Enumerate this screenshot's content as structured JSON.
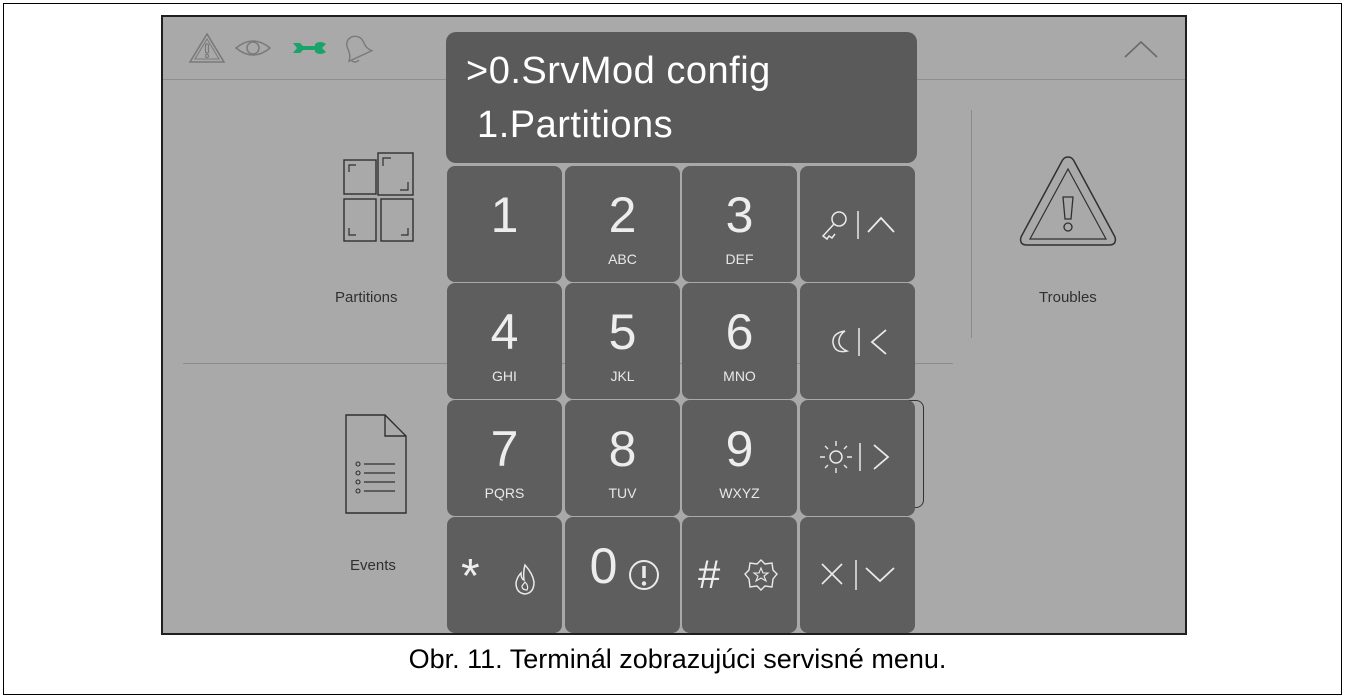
{
  "display": {
    "line1": ">0.SrvMod config",
    "line2": " 1.Partitions"
  },
  "status_icons": [
    "alarm-icon",
    "eye-icon",
    "wrench-icon",
    "bell-icon"
  ],
  "colors": {
    "wrench_active": "#1aa36a",
    "screen_bg": "#a9a9a9",
    "key_bg": "#5e5e5e"
  },
  "tiles": {
    "partitions": "Partitions",
    "troubles": "Troubles",
    "events": "Events"
  },
  "keypad": {
    "k1": {
      "digit": "1",
      "letters": ""
    },
    "k2": {
      "digit": "2",
      "letters": "ABC"
    },
    "k3": {
      "digit": "3",
      "letters": "DEF"
    },
    "k4": {
      "digit": "4",
      "letters": "GHI"
    },
    "k5": {
      "digit": "5",
      "letters": "JKL"
    },
    "k6": {
      "digit": "6",
      "letters": "MNO"
    },
    "k7": {
      "digit": "7",
      "letters": "PQRS"
    },
    "k8": {
      "digit": "8",
      "letters": "TUV"
    },
    "k9": {
      "digit": "9",
      "letters": "WXYZ"
    },
    "kstar": {
      "symbol": "*"
    },
    "k0": {
      "digit": "0"
    },
    "khash": {
      "symbol": "#"
    }
  },
  "caption": "Obr. 11. Terminál zobrazujúci servisné menu."
}
